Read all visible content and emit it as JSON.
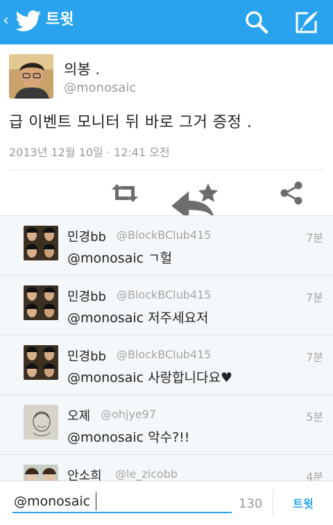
{
  "app": {
    "title": "트윗",
    "accent": "#2aa3ef"
  },
  "icons": {
    "back": "chevron-left-icon",
    "logo": "twitter-bird-icon",
    "search": "search-icon",
    "compose": "compose-icon",
    "reply": "reply-icon",
    "retweet": "retweet-icon",
    "favorite": "star-icon",
    "share": "share-icon"
  },
  "tweet": {
    "author_name": "의봉 .",
    "author_handle": "@monosaic",
    "text": "급 이벤트 모니터 뒤 바로 그거 증정 .",
    "timestamp": "2013년 12월 10일 · 12:41 오전"
  },
  "replies": [
    {
      "name": "민경bb",
      "handle": "@BlockBClub415",
      "age": "7분",
      "text": "@monosaic ㄱ헐"
    },
    {
      "name": "민경bb",
      "handle": "@BlockBClub415",
      "age": "7분",
      "text": "@monosaic 저주세요저"
    },
    {
      "name": "민경bb",
      "handle": "@BlockBClub415",
      "age": "7분",
      "text": "@monosaic 사랑합니다요♥"
    },
    {
      "name": "오졔",
      "handle": "@ohjye97",
      "age": "5분",
      "text": "@monosaic 악수?!!"
    },
    {
      "name": "안소희",
      "handle": "@le_zicobb",
      "age": "4분",
      "text": ""
    }
  ],
  "composer": {
    "value": "@monosaic",
    "char_count": "130",
    "button_label": "트윗"
  }
}
